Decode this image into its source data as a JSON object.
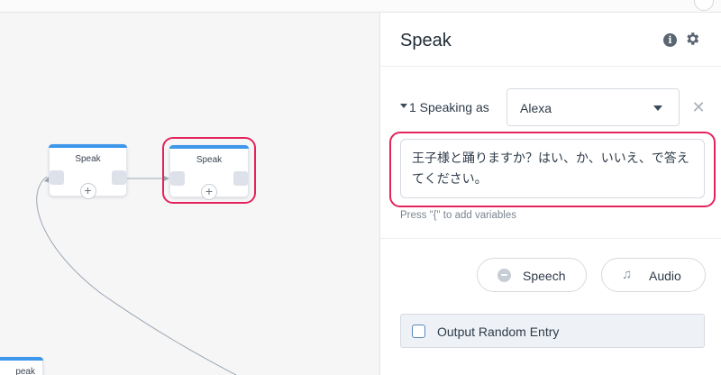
{
  "canvas": {
    "nodes": [
      {
        "title": "Speak"
      },
      {
        "title": "Speak"
      },
      {
        "title": "peak"
      }
    ],
    "plus_symbol": "+"
  },
  "panel": {
    "title": "Speak",
    "info_icon": "info-icon",
    "settings_icon": "gear-icon",
    "speaking_label": "1 Speaking as",
    "voice_value": "Alexa",
    "close_symbol": "✕",
    "text_value": "王子様と踊りますか？はい、か、いいえ、で答えてください。",
    "hint": "Press \"{\" to add variables",
    "buttons": {
      "speech": "Speech",
      "audio": "Audio"
    },
    "random_label": "Output Random Entry"
  },
  "colors": {
    "accent_blue": "#3d97ea",
    "highlight_red": "#e3245c"
  }
}
